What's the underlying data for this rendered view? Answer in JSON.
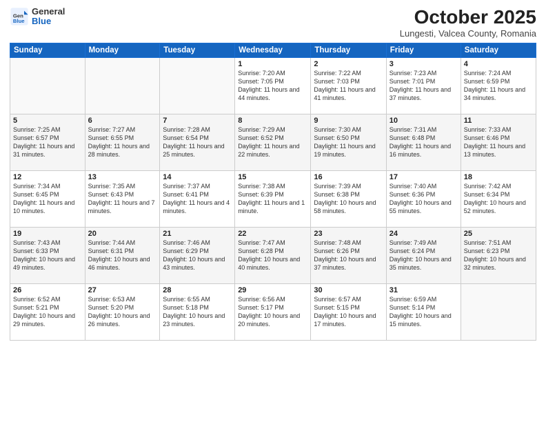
{
  "header": {
    "logo_general": "General",
    "logo_blue": "Blue",
    "month": "October 2025",
    "location": "Lungesti, Valcea County, Romania"
  },
  "weekdays": [
    "Sunday",
    "Monday",
    "Tuesday",
    "Wednesday",
    "Thursday",
    "Friday",
    "Saturday"
  ],
  "weeks": [
    [
      {
        "day": "",
        "info": ""
      },
      {
        "day": "",
        "info": ""
      },
      {
        "day": "",
        "info": ""
      },
      {
        "day": "1",
        "info": "Sunrise: 7:20 AM\nSunset: 7:05 PM\nDaylight: 11 hours and 44 minutes."
      },
      {
        "day": "2",
        "info": "Sunrise: 7:22 AM\nSunset: 7:03 PM\nDaylight: 11 hours and 41 minutes."
      },
      {
        "day": "3",
        "info": "Sunrise: 7:23 AM\nSunset: 7:01 PM\nDaylight: 11 hours and 37 minutes."
      },
      {
        "day": "4",
        "info": "Sunrise: 7:24 AM\nSunset: 6:59 PM\nDaylight: 11 hours and 34 minutes."
      }
    ],
    [
      {
        "day": "5",
        "info": "Sunrise: 7:25 AM\nSunset: 6:57 PM\nDaylight: 11 hours and 31 minutes."
      },
      {
        "day": "6",
        "info": "Sunrise: 7:27 AM\nSunset: 6:55 PM\nDaylight: 11 hours and 28 minutes."
      },
      {
        "day": "7",
        "info": "Sunrise: 7:28 AM\nSunset: 6:54 PM\nDaylight: 11 hours and 25 minutes."
      },
      {
        "day": "8",
        "info": "Sunrise: 7:29 AM\nSunset: 6:52 PM\nDaylight: 11 hours and 22 minutes."
      },
      {
        "day": "9",
        "info": "Sunrise: 7:30 AM\nSunset: 6:50 PM\nDaylight: 11 hours and 19 minutes."
      },
      {
        "day": "10",
        "info": "Sunrise: 7:31 AM\nSunset: 6:48 PM\nDaylight: 11 hours and 16 minutes."
      },
      {
        "day": "11",
        "info": "Sunrise: 7:33 AM\nSunset: 6:46 PM\nDaylight: 11 hours and 13 minutes."
      }
    ],
    [
      {
        "day": "12",
        "info": "Sunrise: 7:34 AM\nSunset: 6:45 PM\nDaylight: 11 hours and 10 minutes."
      },
      {
        "day": "13",
        "info": "Sunrise: 7:35 AM\nSunset: 6:43 PM\nDaylight: 11 hours and 7 minutes."
      },
      {
        "day": "14",
        "info": "Sunrise: 7:37 AM\nSunset: 6:41 PM\nDaylight: 11 hours and 4 minutes."
      },
      {
        "day": "15",
        "info": "Sunrise: 7:38 AM\nSunset: 6:39 PM\nDaylight: 11 hours and 1 minute."
      },
      {
        "day": "16",
        "info": "Sunrise: 7:39 AM\nSunset: 6:38 PM\nDaylight: 10 hours and 58 minutes."
      },
      {
        "day": "17",
        "info": "Sunrise: 7:40 AM\nSunset: 6:36 PM\nDaylight: 10 hours and 55 minutes."
      },
      {
        "day": "18",
        "info": "Sunrise: 7:42 AM\nSunset: 6:34 PM\nDaylight: 10 hours and 52 minutes."
      }
    ],
    [
      {
        "day": "19",
        "info": "Sunrise: 7:43 AM\nSunset: 6:33 PM\nDaylight: 10 hours and 49 minutes."
      },
      {
        "day": "20",
        "info": "Sunrise: 7:44 AM\nSunset: 6:31 PM\nDaylight: 10 hours and 46 minutes."
      },
      {
        "day": "21",
        "info": "Sunrise: 7:46 AM\nSunset: 6:29 PM\nDaylight: 10 hours and 43 minutes."
      },
      {
        "day": "22",
        "info": "Sunrise: 7:47 AM\nSunset: 6:28 PM\nDaylight: 10 hours and 40 minutes."
      },
      {
        "day": "23",
        "info": "Sunrise: 7:48 AM\nSunset: 6:26 PM\nDaylight: 10 hours and 37 minutes."
      },
      {
        "day": "24",
        "info": "Sunrise: 7:49 AM\nSunset: 6:24 PM\nDaylight: 10 hours and 35 minutes."
      },
      {
        "day": "25",
        "info": "Sunrise: 7:51 AM\nSunset: 6:23 PM\nDaylight: 10 hours and 32 minutes."
      }
    ],
    [
      {
        "day": "26",
        "info": "Sunrise: 6:52 AM\nSunset: 5:21 PM\nDaylight: 10 hours and 29 minutes."
      },
      {
        "day": "27",
        "info": "Sunrise: 6:53 AM\nSunset: 5:20 PM\nDaylight: 10 hours and 26 minutes."
      },
      {
        "day": "28",
        "info": "Sunrise: 6:55 AM\nSunset: 5:18 PM\nDaylight: 10 hours and 23 minutes."
      },
      {
        "day": "29",
        "info": "Sunrise: 6:56 AM\nSunset: 5:17 PM\nDaylight: 10 hours and 20 minutes."
      },
      {
        "day": "30",
        "info": "Sunrise: 6:57 AM\nSunset: 5:15 PM\nDaylight: 10 hours and 17 minutes."
      },
      {
        "day": "31",
        "info": "Sunrise: 6:59 AM\nSunset: 5:14 PM\nDaylight: 10 hours and 15 minutes."
      },
      {
        "day": "",
        "info": ""
      }
    ]
  ]
}
